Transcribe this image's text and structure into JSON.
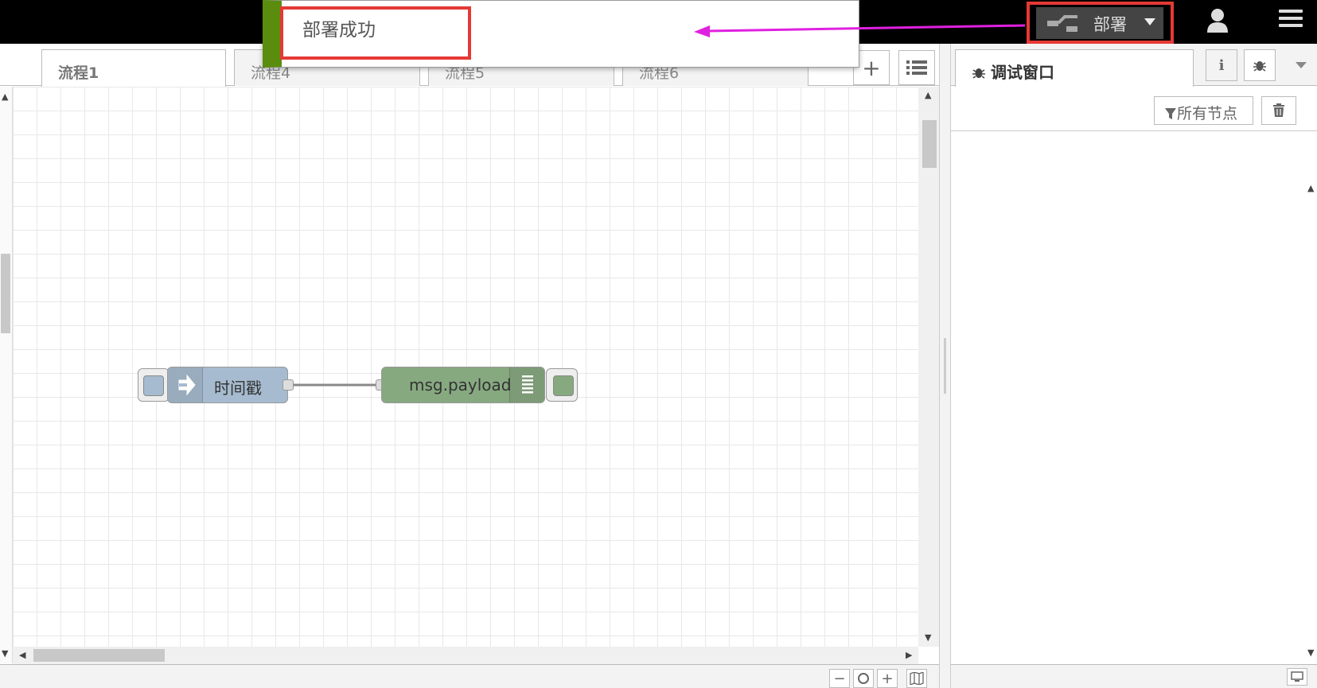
{
  "header": {
    "deploy_label": "部署",
    "icons": [
      "deploy-icon",
      "caret-down-icon",
      "user-icon",
      "menu-icon"
    ]
  },
  "notification": {
    "text": "部署成功",
    "accent": "#5a8d0e"
  },
  "annotations": {
    "highlight_color": "#e53935",
    "arrow_color": "#e020e0"
  },
  "workspace": {
    "tabs": [
      {
        "label": "流程1",
        "active": true
      },
      {
        "label": "流程4",
        "active": false
      },
      {
        "label": "流程5",
        "active": false
      },
      {
        "label": "流程6",
        "active": false
      }
    ],
    "nodes": [
      {
        "label": "时间戳",
        "type": "inject",
        "color": "#a6bbcf"
      },
      {
        "label": "msg.payload",
        "type": "debug",
        "color": "#87a980"
      }
    ]
  },
  "sidebar": {
    "tab_label": "调试窗口",
    "filter_label": "所有节点",
    "icons": [
      "info-icon",
      "bug-icon",
      "caret-down-icon",
      "filter-icon",
      "trash-icon",
      "monitor-icon"
    ]
  }
}
